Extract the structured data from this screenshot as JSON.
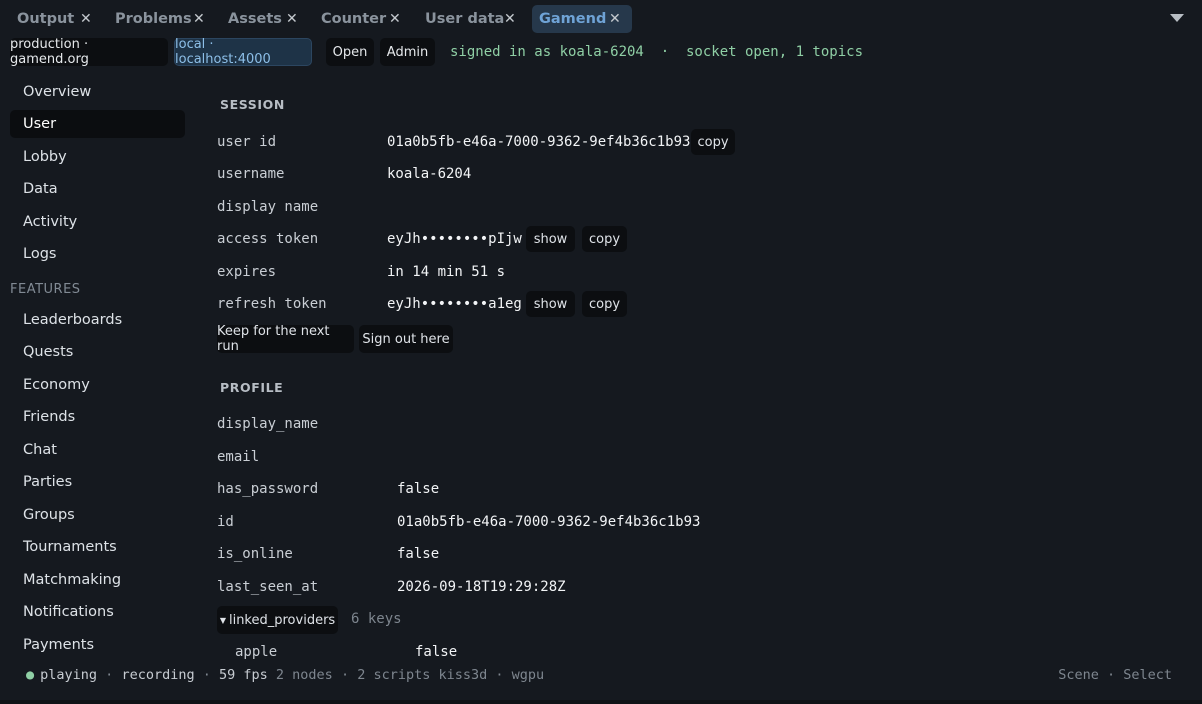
{
  "tabs": [
    {
      "label": "Output",
      "close": "✕"
    },
    {
      "label": "Problems",
      "close": "✕"
    },
    {
      "label": "Assets",
      "close": "✕"
    },
    {
      "label": "Counter",
      "close": "✕"
    },
    {
      "label": "User data",
      "close": "✕"
    },
    {
      "label": "Gamend",
      "close": "✕",
      "active": true
    }
  ],
  "toolbar": {
    "env_production": "production · gamend.org",
    "env_local": "local · localhost:4000",
    "open_label": "Open",
    "admin_label": "Admin",
    "status": "signed in as koala-6204  ·  socket open, 1 topics"
  },
  "sidebar": {
    "items": [
      "Overview",
      "User",
      "Lobby",
      "Data",
      "Activity",
      "Logs"
    ],
    "features_heading": "FEATURES",
    "features": [
      "Leaderboards",
      "Quests",
      "Economy",
      "Friends",
      "Chat",
      "Parties",
      "Groups",
      "Tournaments",
      "Matchmaking",
      "Notifications",
      "Payments"
    ]
  },
  "session": {
    "title": "SESSION",
    "user_id_label": "user id",
    "user_id": "01a0b5fb-e46a-7000-9362-9ef4b36c1b93",
    "username_label": "username",
    "username": "koala-6204",
    "display_name_label": "display name",
    "access_token_label": "access token",
    "access_token": "eyJh••••••••pIjw",
    "expires_label": "expires",
    "expires": "in 14 min 51 s",
    "refresh_token_label": "refresh token",
    "refresh_token": "eyJh••••••••a1eg",
    "copy_label": "copy",
    "show_label": "show",
    "keep_label": "Keep for the next run",
    "sign_out_label": "Sign out here"
  },
  "profile": {
    "title": "PROFILE",
    "display_name_label": "display_name",
    "email_label": "email",
    "has_password_label": "has_password",
    "has_password": "false",
    "id_label": "id",
    "id": "01a0b5fb-e46a-7000-9362-9ef4b36c1b93",
    "is_online_label": "is_online",
    "is_online": "false",
    "last_seen_at_label": "last_seen_at",
    "last_seen_at": "2026-09-18T19:29:28Z",
    "linked_providers_label": "linked_providers",
    "linked_providers_count": "6 keys",
    "apple_label": "apple",
    "apple": "false"
  },
  "footer": {
    "dot": "●",
    "playing": "playing",
    "sep": " · ",
    "recording": "recording",
    "fps": "59 fps",
    "nodes": "2 nodes",
    "scripts": "2 scripts",
    "engine": "kiss3d",
    "backend": "wgpu",
    "scene": "Scene",
    "select": "Select"
  },
  "colors": {
    "background": "#15191f",
    "accent": "#6fa3d6",
    "status_green": "#8fcfa5"
  }
}
